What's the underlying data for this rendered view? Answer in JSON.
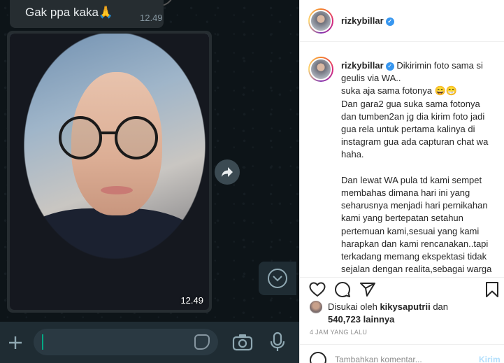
{
  "whatsapp": {
    "top_message": {
      "text": "Gak ppa kaka🙏",
      "time": "12.49"
    },
    "photo_message": {
      "time": "12.49"
    },
    "icons": {
      "share": "forward-arrow-icon",
      "scroll_down": "chevron-down-circle-icon",
      "attach": "plus-icon",
      "sticker": "sticker-icon",
      "camera": "camera-icon",
      "mic": "microphone-icon"
    },
    "colors": {
      "background": "#0d1418",
      "bubble": "#262d31",
      "accent": "#00a884"
    }
  },
  "instagram": {
    "header": {
      "username": "rizkybillar",
      "verified": true
    },
    "caption": {
      "username": "rizkybillar",
      "text": "Dikirimin foto sama si geulis via WA..\nsuka aja sama fotonya 😄😁\nDan gara2 gua suka sama fotonya dan tumben2an jg dia kirim foto jadi gua rela untuk pertama kalinya di instagram gua ada capturan chat wa haha.\n\nDan lewat WA pula td kami sempet membahas dimana hari ini yang seharusnya menjadi hari pernikahan kami yang bertepatan setahun pertemuan kami,sesuai yang kami harapkan dan kami rencanakan..tapi terkadang memang ekspektasi tidak sejalan dengan realita,sebagai warga negara yang baik yg taat dengan kebijakan pemerintah dan sebagai"
    },
    "actions": {
      "like": "heart-icon",
      "comment": "comment-icon",
      "share": "paper-plane-icon",
      "save": "bookmark-icon"
    },
    "likes": {
      "prefix": "Disukai oleh ",
      "user": "kikysaputrii",
      "middle": " dan ",
      "count": "540,723",
      "suffix": " lainnya"
    },
    "time_ago": "4 JAM YANG LALU",
    "comment": {
      "placeholder": "Tambahkan komentar...",
      "post_label": "Kirim"
    },
    "colors": {
      "verified": "#3897f0",
      "post_disabled": "#b2dffc"
    }
  }
}
